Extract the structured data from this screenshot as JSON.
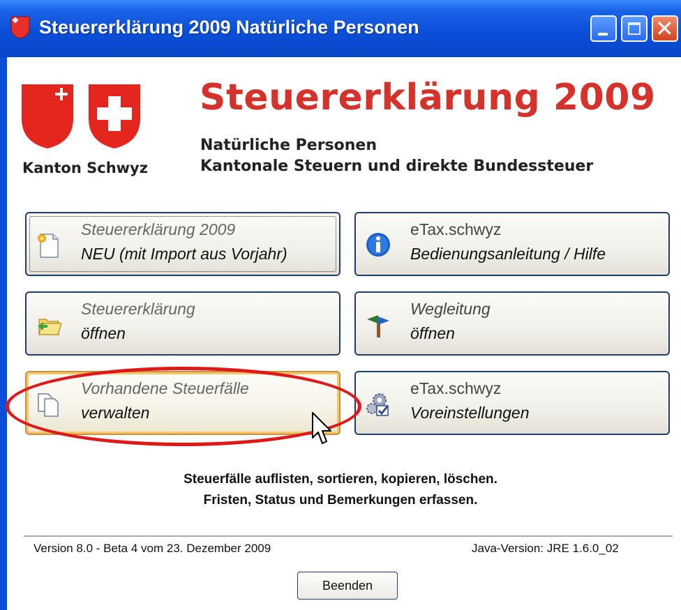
{
  "window": {
    "title": "Steuererklärung 2009 Natürliche Personen",
    "controls": [
      "minimize",
      "maximize",
      "close"
    ],
    "close_glyph": "✕"
  },
  "header": {
    "canton_label": "Kanton Schwyz",
    "title": "Steuererklärung 2009",
    "subtitle_1": "Natürliche Personen",
    "subtitle_2": "Kantonale Steuern und direkte Bundessteuer",
    "accent_color": "#d4322a"
  },
  "actions": {
    "new_return": {
      "line1": "Steuererklärung 2009",
      "line2": "NEU (mit Import aus Vorjahr)",
      "icon": "new-document-icon"
    },
    "help": {
      "line1": "eTax.schwyz",
      "line2": "Bedienungsanleitung / Hilfe",
      "icon": "info-icon"
    },
    "open_return": {
      "line1": "Steuererklärung",
      "line2": "öffnen",
      "icon": "open-folder-icon"
    },
    "guide": {
      "line1": "Wegleitung",
      "line2": "öffnen",
      "icon": "signpost-icon"
    },
    "manage_cases": {
      "line1": "Vorhandene Steuerfälle",
      "line2": "verwalten",
      "icon": "copy-documents-icon"
    },
    "settings": {
      "line1": "eTax.schwyz",
      "line2": "Voreinstellungen",
      "icon": "settings-gear-icon"
    }
  },
  "description": {
    "line1": "Steuerfälle auflisten, sortieren, kopieren, löschen.",
    "line2": "Fristen, Status und Bemerkungen erfassen."
  },
  "footer": {
    "version": "Version 8.0 - Beta 4 vom 23. Dezember 2009",
    "java_version": "Java-Version: JRE 1.6.0_02",
    "quit_label": "Beenden"
  },
  "highlight_color": "#e11818"
}
